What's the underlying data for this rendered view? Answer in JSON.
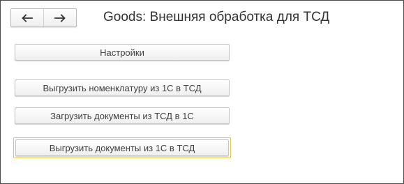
{
  "window": {
    "title": "Goods: Внешняя обработка для ТСД"
  },
  "nav": {
    "back_icon": "arrow-left-icon",
    "forward_icon": "arrow-right-icon"
  },
  "commands": [
    {
      "label": "Настройки"
    },
    {
      "label": "Выгрузить номенклатуру из 1С в ТСД"
    },
    {
      "label": "Загрузить документы из ТСД в 1С"
    },
    {
      "label": "Выгрузить документы из 1С в ТСД"
    }
  ],
  "colors": {
    "focus_border": "#e8c84a",
    "text": "#404040"
  }
}
